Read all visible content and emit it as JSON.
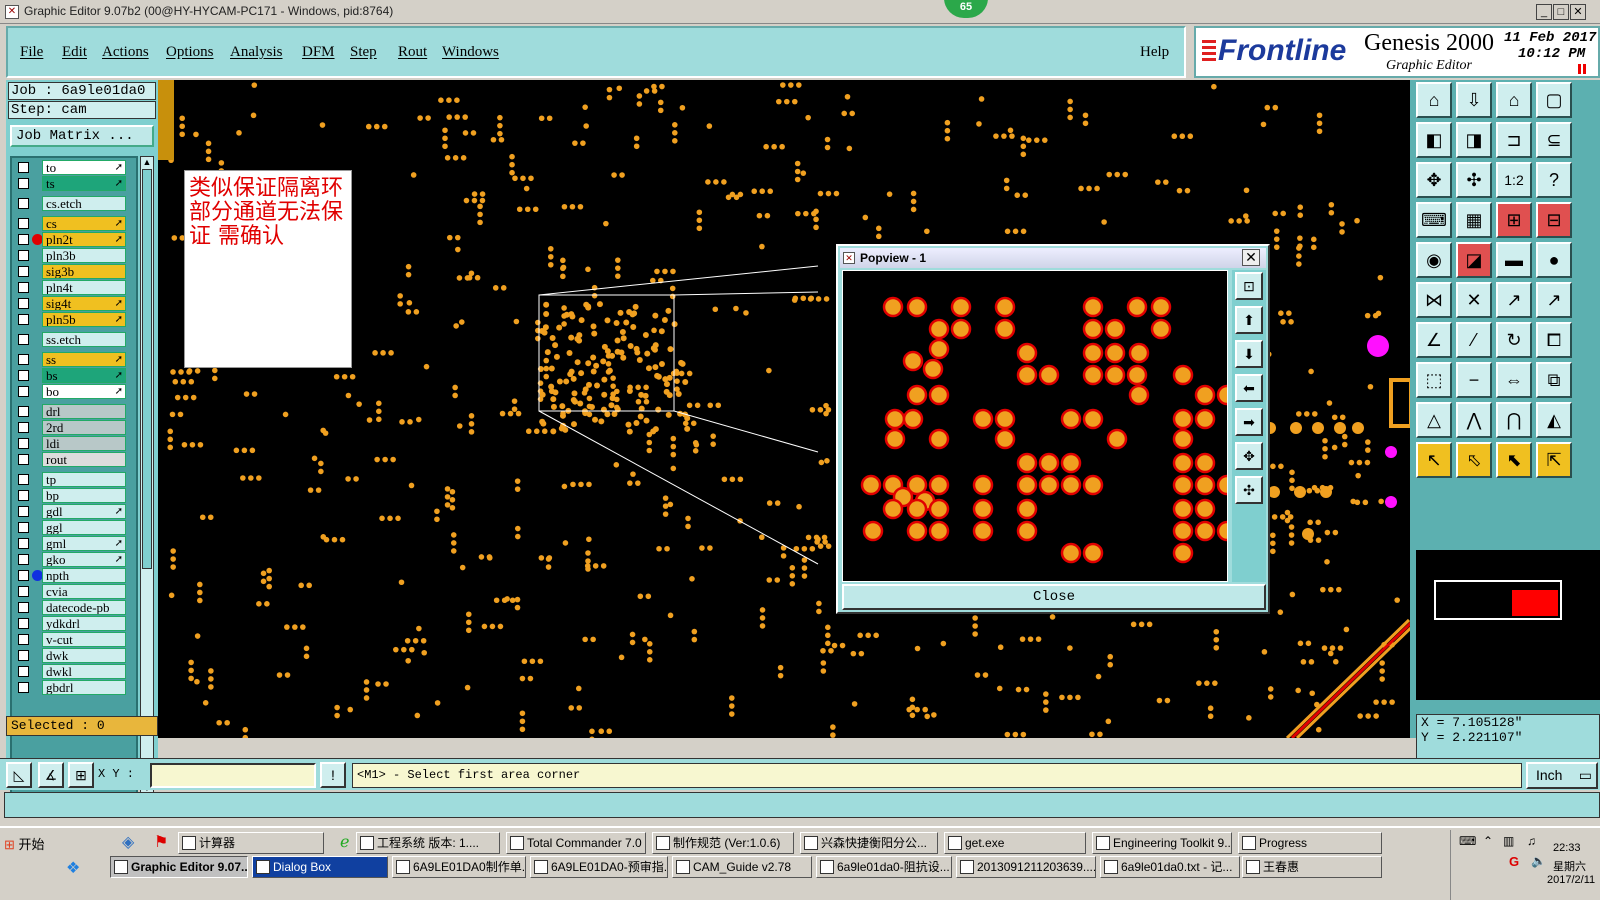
{
  "window": {
    "title": "Graphic Editor 9.07b2 (00@HY-HYCAM-PC171 - Windows, pid:8764)",
    "badge": "65",
    "minimize": "_",
    "restore": "□",
    "close": "✕"
  },
  "menu": {
    "items": [
      "File",
      "Edit",
      "Actions",
      "Options",
      "Analysis",
      "DFM",
      "Step",
      "Rout",
      "Windows"
    ],
    "help": "Help"
  },
  "brand": {
    "logo": "Frontline",
    "product": "Genesis 2000",
    "subtitle": "Graphic Editor",
    "date": "11 Feb 2017",
    "time": "10:12 PM"
  },
  "job": {
    "job": "Job : 6a9le01da0",
    "step": "Step: cam",
    "matrix": "Job Matrix ..."
  },
  "layers": [
    {
      "name": "to",
      "color": "#ffffff",
      "arrow": true
    },
    {
      "name": "ts",
      "color": "#1ea57a",
      "arrow": true
    },
    {
      "name": "cs.etch",
      "color": "#cfeeee",
      "arrow": false
    },
    {
      "name": "cs",
      "color": "#f0c020",
      "arrow": true
    },
    {
      "name": "pln2t",
      "color": "#f0c020",
      "arrow": true,
      "dot": "#e00000"
    },
    {
      "name": "pln3b",
      "color": "#cfeeee",
      "arrow": false
    },
    {
      "name": "sig3b",
      "color": "#f0c020",
      "arrow": false
    },
    {
      "name": "pln4t",
      "color": "#cfeeee",
      "arrow": false
    },
    {
      "name": "sig4t",
      "color": "#f0c020",
      "arrow": true
    },
    {
      "name": "pln5b",
      "color": "#f0c020",
      "arrow": true
    },
    {
      "name": "ss.etch",
      "color": "#cfeeee",
      "arrow": false
    },
    {
      "name": "ss",
      "color": "#f0c020",
      "arrow": true
    },
    {
      "name": "bs",
      "color": "#1ea57a",
      "arrow": true
    },
    {
      "name": "bo",
      "color": "#ffffff",
      "arrow": true
    },
    {
      "name": "drl",
      "color": "#b8c8c8",
      "arrow": false
    },
    {
      "name": "2rd",
      "color": "#b8c8c8",
      "arrow": false
    },
    {
      "name": "ldi",
      "color": "#b8c8c8",
      "arrow": false
    },
    {
      "name": "rout",
      "color": "#dcdcdc",
      "arrow": false
    },
    {
      "name": "tp",
      "color": "#cfeeee",
      "arrow": false
    },
    {
      "name": "bp",
      "color": "#cfeeee",
      "arrow": false
    },
    {
      "name": "gdl",
      "color": "#cfeeee",
      "arrow": true
    },
    {
      "name": "ggl",
      "color": "#cfeeee",
      "arrow": false
    },
    {
      "name": "gml",
      "color": "#cfeeee",
      "arrow": true
    },
    {
      "name": "gko",
      "color": "#cfeeee",
      "arrow": true
    },
    {
      "name": "npth",
      "color": "#cfeeee",
      "arrow": false,
      "dot": "#1030e0"
    },
    {
      "name": "cvia",
      "color": "#cfeeee",
      "arrow": false
    },
    {
      "name": "datecode-pb",
      "color": "#cfeeee",
      "arrow": false
    },
    {
      "name": "ydkdrl",
      "color": "#cfeeee",
      "arrow": false
    },
    {
      "name": "v-cut",
      "color": "#cfeeee",
      "arrow": false
    },
    {
      "name": "dwk",
      "color": "#cfeeee",
      "arrow": false
    },
    {
      "name": "dwkl",
      "color": "#cfeeee",
      "arrow": false
    },
    {
      "name": "gbdrl",
      "color": "#cfeeee",
      "arrow": false
    }
  ],
  "selected": "Selected : 0",
  "note": "类似保证隔离环 部分通道无法保证 需确认",
  "popview": {
    "title": "Popview - 1",
    "close_label": "Close"
  },
  "coords": {
    "x": "X = 7.105128\"",
    "y": "Y = 2.221107\""
  },
  "command": {
    "xy_label": "X Y :",
    "message": "<M1> - Select first area corner",
    "unit": "Inch"
  },
  "taskbar": {
    "start": "开始",
    "row1": [
      "计算器",
      "工程系统 版本: 1....",
      "Total Commander 7.0 ...",
      "制作规范 (Ver:1.0.6)",
      "兴森快捷衡阳分公...",
      "get.exe",
      "Engineering Toolkit 9....",
      "Progress"
    ],
    "row2": [
      "Graphic Editor 9.07...",
      "Dialog Box",
      "6A9LE01DA0制作单....",
      "6A9LE01DA0-预审指...",
      "CAM_Guide v2.78",
      "6a9le01da0-阻抗设...",
      "2013091211203639....",
      "6a9le01da0.txt - 记...",
      "王春惠"
    ],
    "clock": "22:33",
    "weekday": "星期六",
    "date": "2017/2/11"
  },
  "colors": {
    "panel": "#9fdcdc",
    "pad_fill": "#f0a020",
    "pad_ring": "#e00000",
    "canvas": "#000000"
  }
}
